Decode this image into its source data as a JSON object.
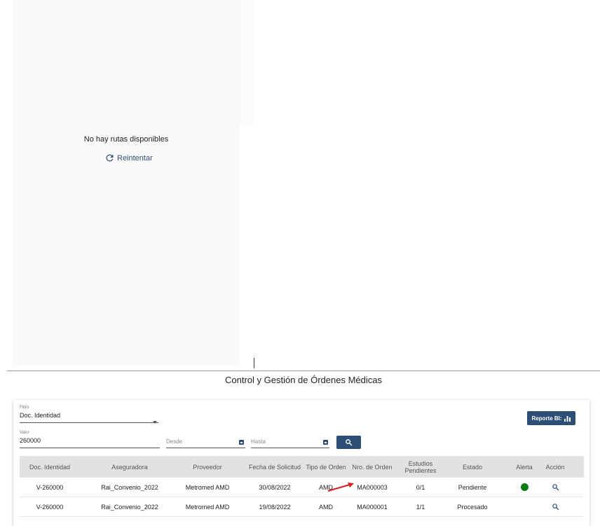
{
  "route_panel": {
    "empty_message": "No hay rutas disponibles",
    "retry_label": "Reintentar"
  },
  "page": {
    "title": "Control y Gestión de Órdenes Médicas"
  },
  "filters": {
    "filtro_label": "Filtro",
    "filtro_value": "Doc. Identidad",
    "valor_label": "Valor",
    "valor_value": "260000",
    "desde_placeholder": "Desde",
    "hasta_placeholder": "Hasta"
  },
  "report_button": {
    "label": "Reporte BI:"
  },
  "table": {
    "headers": [
      "Doc. Identidad",
      "Aseguradora",
      "Proveedor",
      "Fecha de Solicitud",
      "Tipo de Orden",
      "Nro. de Orden",
      "Estudios Pendientes",
      "Estado",
      "Alerta",
      "Acción"
    ],
    "rows": [
      {
        "doc": "V-260000",
        "aseguradora": "Rai_Convenio_2022",
        "proveedor": "Metromed AMD",
        "fecha": "30/08/2022",
        "tipo": "AMD",
        "nro": "MA000003",
        "pendientes": "0/1",
        "estado": "Pendiente",
        "alerta": "green"
      },
      {
        "doc": "V-260000",
        "aseguradora": "Rai_Convenio_2022",
        "proveedor": "Metromed AMD",
        "fecha": "19/08/2022",
        "tipo": "AMD",
        "nro": "MA000001",
        "pendientes": "1/1",
        "estado": "Procesado",
        "alerta": ""
      }
    ]
  },
  "icons": {
    "retry": "refresh-icon",
    "search": "search-icon",
    "report": "bar-chart-icon",
    "calendar": "calendar-icon",
    "row_action": "magnifier-icon"
  },
  "colors": {
    "primary": "#2d4f76",
    "alert_green": "#0a7d10",
    "annotation_arrow": "#d32020"
  }
}
